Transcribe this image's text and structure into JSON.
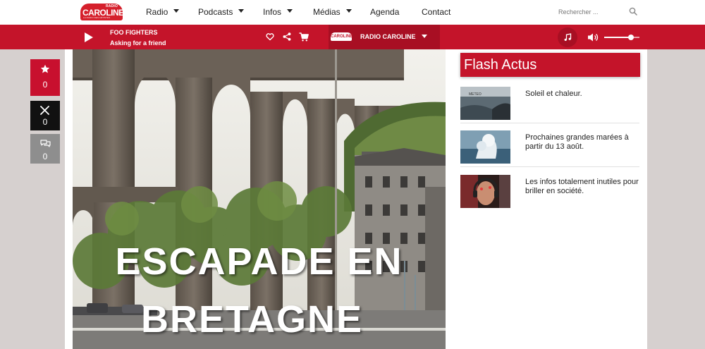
{
  "logo": {
    "small": "RADIO",
    "main": "CAROLINE",
    "tag": "LA RADIO DES ARTISTES"
  },
  "nav": [
    {
      "label": "Radio",
      "dropdown": true
    },
    {
      "label": "Podcasts",
      "dropdown": true
    },
    {
      "label": "Infos",
      "dropdown": true
    },
    {
      "label": "Médias",
      "dropdown": true
    },
    {
      "label": "Agenda",
      "dropdown": false
    },
    {
      "label": "Contact",
      "dropdown": false
    }
  ],
  "search": {
    "placeholder": "Rechercher ..."
  },
  "player": {
    "artist": "FOO FIGHTERS",
    "track": "Asking for a friend",
    "station_logo": "CAROLINE",
    "station_name": "RADIO CAROLINE",
    "volume": 0.75
  },
  "share": {
    "favorites": "0",
    "x": "0",
    "comments": "0"
  },
  "article": {
    "title_line1": "ESCAPADE EN",
    "title_line2": "BRETAGNE"
  },
  "flash": {
    "title": "Flash Actus",
    "items": [
      {
        "text": "Soleil et chaleur.",
        "thumb_label": "METEO"
      },
      {
        "text": "Prochaines grandes marées à partir du 13 août."
      },
      {
        "text": "Les infos totalement inutiles pour briller en société."
      }
    ]
  },
  "colors": {
    "brand_red": "#c4142a",
    "dark_red": "#a80f23",
    "x_black": "#111111",
    "comment_grey": "#8e8e8e"
  }
}
